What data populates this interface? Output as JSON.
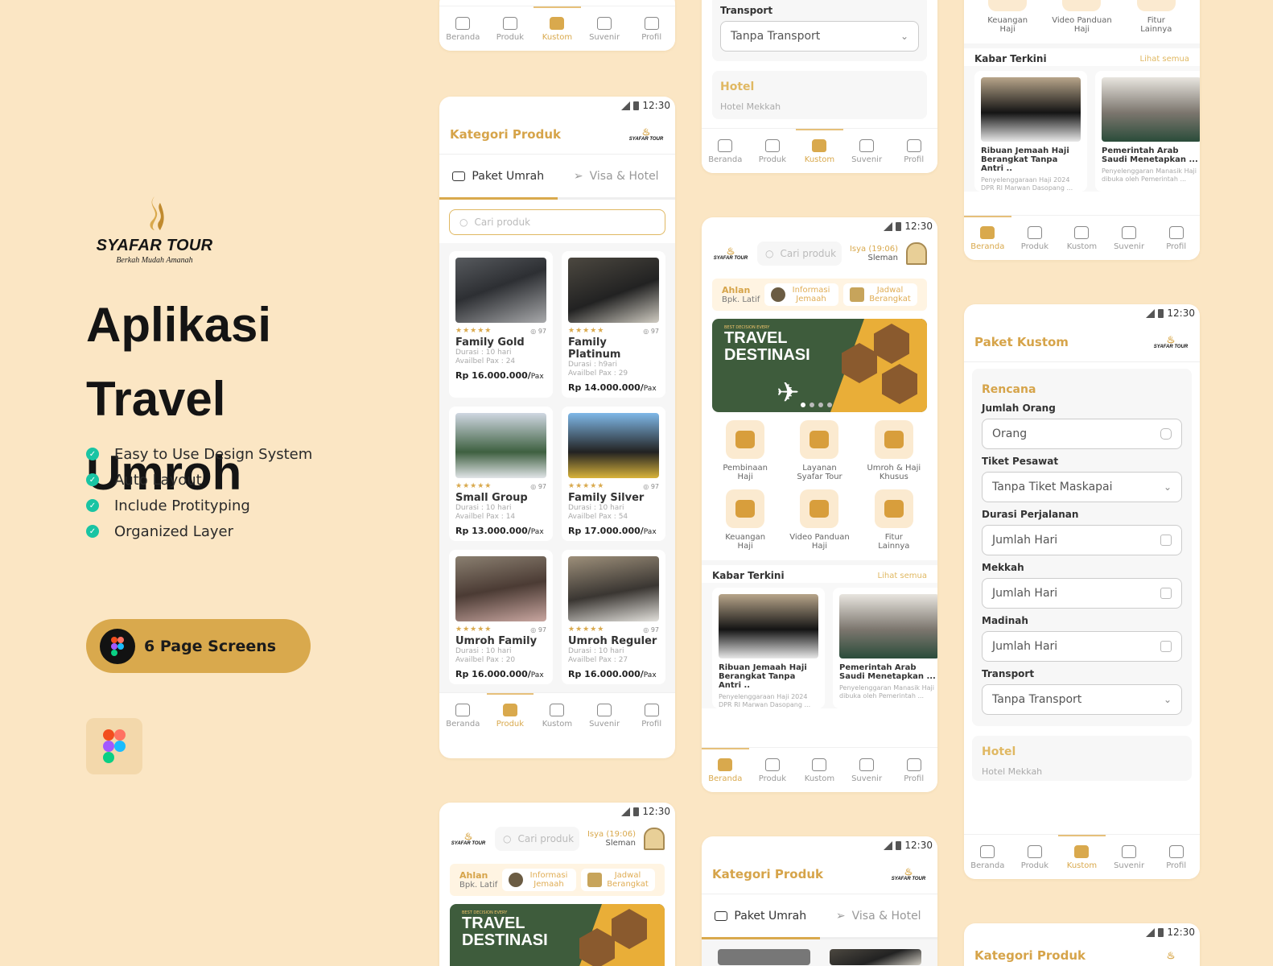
{
  "brand": {
    "name": "SYAFAR TOUR",
    "tagline": "Berkah Mudah Amanah"
  },
  "hero": {
    "title_line1": "Aplikasi Travel",
    "title_line2": "Umroh",
    "features": [
      "Easy to Use Design System",
      "Auto Layout",
      "Include Protityping",
      "Organized Layer"
    ],
    "screens_label": "6 Page Screens"
  },
  "colors": {
    "accent": "#d9a94d",
    "background": "#fbe6c4",
    "check": "#19c4a3"
  },
  "status": {
    "time": "12:30"
  },
  "nav": {
    "items": [
      "Beranda",
      "Produk",
      "Kustom",
      "Suvenir",
      "Profil"
    ]
  },
  "catalog": {
    "title": "Kategori Produk",
    "tab_umrah": "Paket Umrah",
    "tab_visa": "Visa & Hotel",
    "search_placeholder": "Cari produk",
    "products": [
      {
        "name": "Family Gold",
        "reviews": "97",
        "durasi": "Durasi : 10 hari",
        "pax": "Availbel Pax : 24",
        "price": "Rp 16.000.000/",
        "unit": "Pax"
      },
      {
        "name": "Family Platinum",
        "reviews": "97",
        "durasi": "Durasi : h9ari",
        "pax": "Availbel Pax : 29",
        "price": "Rp 14.000.000/",
        "unit": "Pax"
      },
      {
        "name": "Small Group",
        "reviews": "97",
        "durasi": "Durasi : 10 hari",
        "pax": "Availbel Pax : 14",
        "price": "Rp 13.000.000/",
        "unit": "Pax"
      },
      {
        "name": "Family Silver",
        "reviews": "97",
        "durasi": "Durasi : 10 hari",
        "pax": "Availbel Pax : 54",
        "price": "Rp 17.000.000/",
        "unit": "Pax"
      },
      {
        "name": "Umroh Family",
        "reviews": "97",
        "durasi": "Durasi : 10 hari",
        "pax": "Availbel Pax : 20",
        "price": "Rp 16.000.000/",
        "unit": "Pax"
      },
      {
        "name": "Umroh Reguler",
        "reviews": "97",
        "durasi": "Durasi : 10 hari",
        "pax": "Availbel Pax : 27",
        "price": "Rp 16.000.000/",
        "unit": "Pax"
      }
    ]
  },
  "home": {
    "search_placeholder": "Cari produk",
    "prayer_time": "Isya (19:06)",
    "location": "Sleman",
    "greeting": "Ahlan",
    "user": "Bpk. Latif",
    "btn_info": "Informasi Jemaah",
    "btn_jadwal": "Jadwal Berangkat",
    "banner_kicker": "BEST DECISION EVERY",
    "banner_title_1": "TRAVEL",
    "banner_title_2": "DESTINASI",
    "menu": [
      "Pembinaan Haji",
      "Layanan Syafar Tour",
      "Umroh & Haji Khusus",
      "Keuangan Haji",
      "Video Panduan Haji",
      "Fitur Lainnya"
    ],
    "news_title": "Kabar Terkini",
    "news_more": "Lihat semua",
    "news": [
      {
        "title": "Ribuan Jemaah Haji Berangkat Tanpa Antri ..",
        "desc": "Penyelenggaraan Haji 2024 DPR RI Marwan Dasopang ..."
      },
      {
        "title": "Pemerintah Arab Saudi Menetapkan ...",
        "desc": "Penyelenggaran Manasik Haji dibuka oleh Pemerintah ..."
      }
    ]
  },
  "custom": {
    "title": "Paket Kustom",
    "section_plan": "Rencana",
    "section_hotel": "Hotel",
    "hotel_mekkah": "Hotel Mekkah",
    "fields": [
      {
        "label": "Jumlah Orang",
        "value": "Orang"
      },
      {
        "label": "Tiket Pesawat",
        "value": "Tanpa Tiket Maskapai"
      },
      {
        "label": "Durasi Perjalanan",
        "value": "Jumlah Hari"
      },
      {
        "label": "Mekkah",
        "value": "Jumlah Hari"
      },
      {
        "label": "Madinah",
        "value": "Jumlah Hari"
      },
      {
        "label": "Transport",
        "value": "Tanpa Transport"
      }
    ]
  }
}
